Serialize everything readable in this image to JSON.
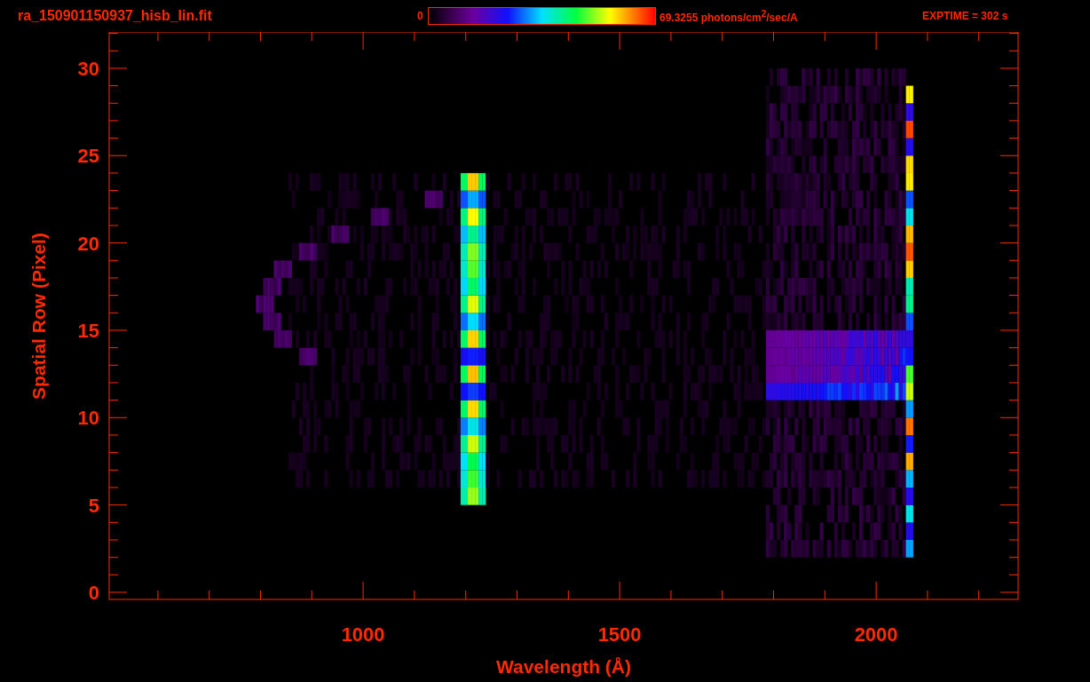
{
  "header": {
    "file_name": "ra_150901150937_hisb_lin.fit",
    "colorbar_min": "0",
    "colorbar_max": "69.3255 photons/cm$^{2}$/sec/A",
    "exposure": "EXPTIME = 302 s"
  },
  "plot": {
    "xlabel": "Wavelength (Å)",
    "ylabel": "Spatial Row (Pixel)",
    "x_tick_labels": [
      "1000",
      "1500",
      "2000"
    ],
    "y_tick_labels": [
      "30",
      "25",
      "20",
      "15",
      "10",
      "5",
      "0"
    ]
  }
}
